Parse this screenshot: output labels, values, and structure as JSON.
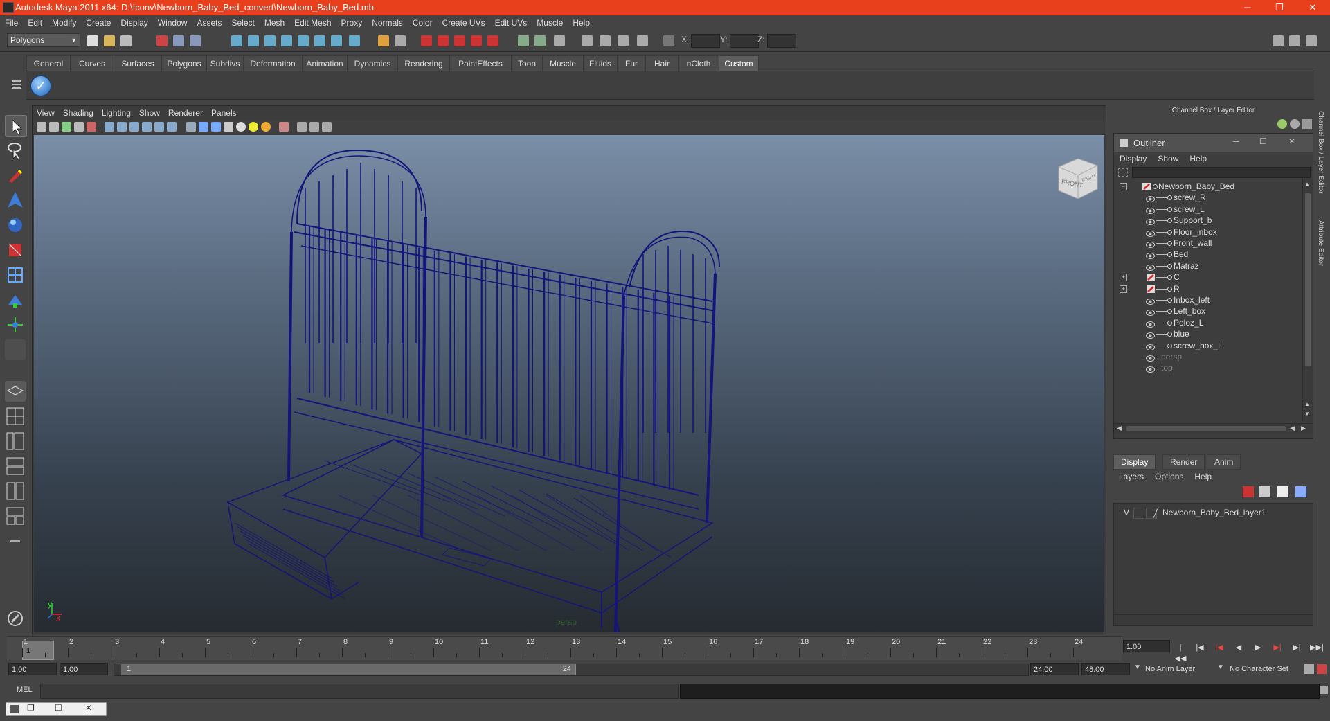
{
  "window": {
    "title": "Autodesk Maya 2011 x64: D:\\!conv\\Newborn_Baby_Bed_convert\\Newborn_Baby_Bed.mb",
    "minimize": "─",
    "maximize": "❐",
    "close": "✕"
  },
  "menubar": [
    "File",
    "Edit",
    "Modify",
    "Create",
    "Display",
    "Window",
    "Assets",
    "Select",
    "Mesh",
    "Edit Mesh",
    "Proxy",
    "Normals",
    "Color",
    "Create UVs",
    "Edit UVs",
    "Muscle",
    "Help"
  ],
  "statusline": {
    "mode": "Polygons",
    "x_label": "X:",
    "y_label": "Y:",
    "z_label": "Z:"
  },
  "shelf_tabs": [
    "General",
    "Curves",
    "Surfaces",
    "Polygons",
    "Subdivs",
    "Deformation",
    "Animation",
    "Dynamics",
    "Rendering",
    "PaintEffects",
    "Toon",
    "Muscle",
    "Fluids",
    "Fur",
    "Hair",
    "nCloth",
    "Custom"
  ],
  "shelf_active": "Custom",
  "viewport": {
    "menu": [
      "View",
      "Shading",
      "Lighting",
      "Show",
      "Renderer",
      "Panels"
    ],
    "camera_label": "persp",
    "viewcube_front": "FRONT",
    "viewcube_right": "RIGHT",
    "axis_y": "y",
    "axis_x": "x",
    "wire_color": "#14147a"
  },
  "channel_box": {
    "title": "Channel Box / Layer Editor",
    "side_tab_1": "Channel Box / Layer Editor",
    "side_tab_2": "Attribute Editor"
  },
  "outliner": {
    "title": "Outliner",
    "menu": [
      "Display",
      "Show",
      "Help"
    ],
    "root": "Newborn_Baby_Bed",
    "items": [
      {
        "label": "screw_R",
        "group": false
      },
      {
        "label": "screw_L",
        "group": false
      },
      {
        "label": "Support_b",
        "group": false
      },
      {
        "label": "Floor_inbox",
        "group": false
      },
      {
        "label": "Front_wall",
        "group": false
      },
      {
        "label": "Bed",
        "group": false
      },
      {
        "label": "Matraz",
        "group": false
      },
      {
        "label": "C",
        "group": true
      },
      {
        "label": "R",
        "group": true
      },
      {
        "label": "Inbox_left",
        "group": false
      },
      {
        "label": "Left_box",
        "group": false
      },
      {
        "label": "Poloz_L",
        "group": false
      },
      {
        "label": "blue",
        "group": false
      },
      {
        "label": "screw_box_L",
        "group": false
      }
    ],
    "cameras": [
      "persp",
      "top"
    ],
    "expand_minus": "−",
    "expand_plus": "+"
  },
  "layer_editor": {
    "tabs": [
      "Display",
      "Render",
      "Anim"
    ],
    "active_tab": "Display",
    "menu": [
      "Layers",
      "Options",
      "Help"
    ],
    "layer_visible": "V",
    "layer_name": "Newborn_Baby_Bed_layer1"
  },
  "timeline": {
    "ticks": [
      "1",
      "2",
      "3",
      "4",
      "5",
      "6",
      "7",
      "8",
      "9",
      "10",
      "11",
      "12",
      "13",
      "14",
      "15",
      "16",
      "17",
      "18",
      "19",
      "20",
      "21",
      "22",
      "23",
      "24"
    ],
    "current_frame": "1",
    "current_time": "1.00"
  },
  "range": {
    "start": "1.00",
    "start2": "1.00",
    "range_start": "1",
    "range_end": "24",
    "end": "24.00",
    "end2": "48.00",
    "anim_layer": "No Anim Layer",
    "character_set": "No Character Set"
  },
  "command": {
    "mel_label": "MEL"
  }
}
